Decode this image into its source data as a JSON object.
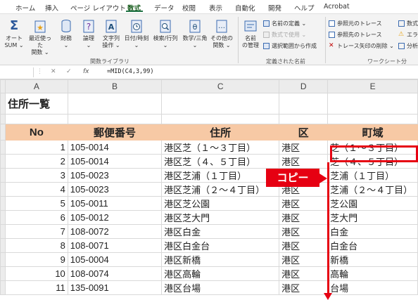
{
  "ribbon_tabs": [
    "ホーム",
    "挿入",
    "ページ レイアウト",
    "数式",
    "データ",
    "校閲",
    "表示",
    "自動化",
    "開発",
    "ヘルプ",
    "Acrobat"
  ],
  "active_tab": "数式",
  "ribbon": {
    "autosum": "オート\nSUM ⌄",
    "recent": "最近使った\n関数 ⌄",
    "financial": "財務\n⌄",
    "logical": "論理\n⌄",
    "text": "文字列\n操作 ⌄",
    "datetime": "日付/時刻\n⌄",
    "lookup": "検索/行列\n⌄",
    "math": "数学/三角\n⌄",
    "more": "その他の\n関数 ⌄",
    "group_library": "関数ライブラリ",
    "name_manager": "名前\nの管理",
    "define_name": "名前の定義 ⌄",
    "use_in_formula": "数式で使用 ⌄",
    "create_from_selection": "選択範囲から作成",
    "group_names": "定義された名前",
    "trace_precedents": "参照元のトレース",
    "trace_dependents": "参照先のトレース",
    "remove_arrows": "トレース矢印の削除 ⌄",
    "show_formulas": "数式",
    "error_check": "エラー",
    "evaluate": "分析",
    "group_audit": "ワークシート分"
  },
  "formula_bar": {
    "name_box": "",
    "cancel": "✕",
    "enter": "✓",
    "fx": "fx",
    "formula": "=MID(C4,3,99)"
  },
  "columns": [
    "A",
    "B",
    "C",
    "D",
    "E"
  ],
  "title": "住所一覧",
  "headers": [
    "No",
    "郵便番号",
    "住所",
    "区",
    "町域"
  ],
  "rows": [
    {
      "no": "1",
      "zip": "105-0014",
      "addr": "港区芝（１～３丁目）",
      "ku": "港区",
      "town": "芝（１～３丁目）"
    },
    {
      "no": "2",
      "zip": "105-0014",
      "addr": "港区芝（４、５丁目）",
      "ku": "港区",
      "town": "芝（４、５丁目）"
    },
    {
      "no": "3",
      "zip": "105-0023",
      "addr": "港区芝浦（１丁目）",
      "ku": "港区",
      "town": "芝浦（１丁目）"
    },
    {
      "no": "4",
      "zip": "105-0023",
      "addr": "港区芝浦（２～４丁目）",
      "ku": "港区",
      "town": "芝浦（２～４丁目）"
    },
    {
      "no": "5",
      "zip": "105-0011",
      "addr": "港区芝公園",
      "ku": "港区",
      "town": "芝公園"
    },
    {
      "no": "6",
      "zip": "105-0012",
      "addr": "港区芝大門",
      "ku": "港区",
      "town": "芝大門"
    },
    {
      "no": "7",
      "zip": "108-0072",
      "addr": "港区白金",
      "ku": "港区",
      "town": "白金"
    },
    {
      "no": "8",
      "zip": "108-0071",
      "addr": "港区白金台",
      "ku": "港区",
      "town": "白金台"
    },
    {
      "no": "9",
      "zip": "105-0004",
      "addr": "港区新橋",
      "ku": "港区",
      "town": "新橋"
    },
    {
      "no": "10",
      "zip": "108-0074",
      "addr": "港区高輪",
      "ku": "港区",
      "town": "高輪"
    },
    {
      "no": "11",
      "zip": "135-0091",
      "addr": "港区台場",
      "ku": "港区",
      "town": "台場"
    }
  ],
  "callout": "コピー",
  "colors": {
    "accent": "#e60012",
    "header_fill": "#f7c9a5",
    "excel_green": "#217346"
  }
}
